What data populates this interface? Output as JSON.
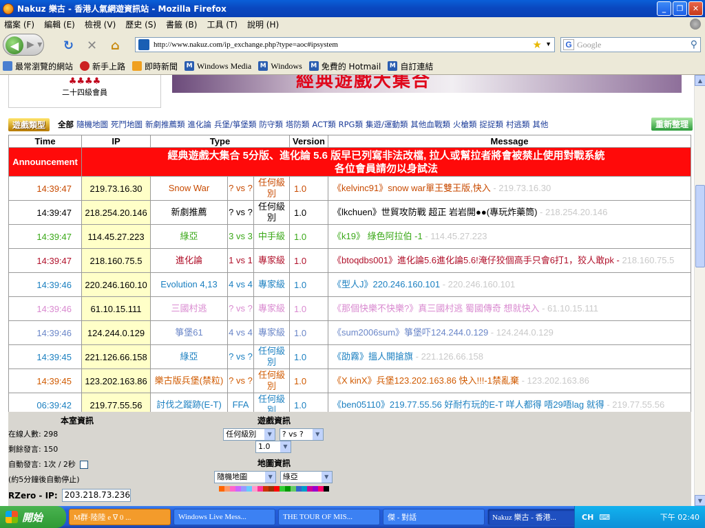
{
  "window": {
    "title": "Nakuz 樂古 - 香港人氣網遊資訊站 - Mozilla Firefox",
    "minimize": "_",
    "maximize": "❐",
    "close": "✕"
  },
  "menu": [
    "檔案 (F)",
    "編輯 (E)",
    "檢視 (V)",
    "歷史 (S)",
    "書籤 (B)",
    "工具 (T)",
    "說明 (H)"
  ],
  "nav": {
    "url": "http://www.nakuz.com/ip_exchange.php?type=aoc#ipsystem",
    "search_placeholder": "Google"
  },
  "bookmarks": [
    "最常瀏覽的網站",
    "新手上路",
    "即時新聞",
    "Windows Media",
    "Windows",
    "免費的 Hotmail",
    "自訂連結"
  ],
  "member": {
    "stars": "♣♣♣♣",
    "level": "二十四級會員"
  },
  "banner_text": "經典遊戲大集合",
  "categories": {
    "label": "遊戲類型",
    "items": [
      "全部",
      "隨機地圖",
      "死鬥地圖",
      "新劇推薦類",
      "進化論",
      "兵堡/箏堡類",
      "防守類",
      "塔防類",
      "ACT類",
      "RPG類",
      "集遊/運動類",
      "其他血戰類",
      "火槍類",
      "捉捉類",
      "村逃類",
      "其他"
    ],
    "refresh": "重新整理"
  },
  "table": {
    "headers": [
      "Time",
      "IP",
      "Type",
      "Version",
      "Message"
    ],
    "announcement_label": "Announcement",
    "announcement": [
      "經典遊戲大集合 5分版、進化論 5.6 版早已列寫非法改檔, 拉人或幫拉者將會被禁止使用對戰系統",
      "各位會員請勿以身試法"
    ],
    "rows": [
      {
        "time": "14:39:47",
        "ip": "219.73.16.30",
        "name": "Snow War",
        "vs": "? vs ?",
        "level": "任何級別",
        "version": "1.0",
        "msg": "《kelvinc91》snow war單王雙王版,快入",
        "msg_ip": " - 219.73.16.30",
        "color": "#c84a00"
      },
      {
        "time": "14:39:47",
        "ip": "218.254.20.146",
        "name": "新劇推薦",
        "vs": "? vs ?",
        "level": "任何級別",
        "version": "1.0",
        "msg": "《lkchuen》世貿攻防戰 超正 岩岩開●●(專玩炸藥筒)",
        "msg_ip": " - 218.254.20.146",
        "color": "#000000"
      },
      {
        "time": "14:39:47",
        "ip": "114.45.27.223",
        "name": "綠亞",
        "vs": "3 vs 3",
        "level": "中手級",
        "version": "1.0",
        "msg": "《k19》 綠色阿拉伯 -1",
        "msg_ip": " - 114.45.27.223",
        "color": "#3aa818"
      },
      {
        "time": "14:39:47",
        "ip": "218.160.75.5",
        "name": "進化論",
        "vs": "1 vs 1",
        "level": "專家級",
        "version": "1.0",
        "msg": "《btoqdbs001》進化論5.6進化論5.6!淹仔狡個高手只會6打1，狡人敢pk -",
        "msg_ip": " 218.160.75.5",
        "color": "#b0102a"
      },
      {
        "time": "14:39:46",
        "ip": "220.246.160.10",
        "name": "Evolution 4,13",
        "vs": "4 vs 4",
        "level": "專家級",
        "version": "1.0",
        "msg": "《型人J》220.246.160.101",
        "msg_ip": " - 220.246.160.101",
        "color": "#1a7fc0"
      },
      {
        "time": "14:39:46",
        "ip": "61.10.15.111",
        "name": "三國村逃",
        "vs": "? vs ?",
        "level": "專家級",
        "version": "1.0",
        "msg": "《那個快樂不快樂?》真三國村逃 蜀國傳奇 想就快入",
        "msg_ip": " - 61.10.15.111",
        "color": "#d98ad0"
      },
      {
        "time": "14:39:46",
        "ip": "124.244.0.129",
        "name": "箏堡61",
        "vs": "4 vs 4",
        "level": "專家級",
        "version": "1.0",
        "msg": "《sum2006sum》箏堡吓124.244.0.129",
        "msg_ip": " - 124.244.0.129",
        "color": "#6a86c8"
      },
      {
        "time": "14:39:45",
        "ip": "221.126.66.158",
        "name": "綠亞",
        "vs": "? vs ?",
        "level": "任何級別",
        "version": "1.0",
        "msg": "《劭霧》搵人開搶旗",
        "msg_ip": " - 221.126.66.158",
        "color": "#1a7fc0"
      },
      {
        "time": "14:39:45",
        "ip": "123.202.163.86",
        "name": "樂古版兵堡(禁粒)",
        "vs": "? vs ?",
        "level": "任何級別",
        "version": "1.0",
        "msg": "《X kinX》兵堡123.202.163.86 快入!!!-1禁亂棄",
        "msg_ip": " - 123.202.163.86",
        "color": "#d05a00"
      },
      {
        "time": "06:39:42",
        "ip": "219.77.55.56",
        "name": "討伐之蹤跡(E-T)",
        "vs": "FFA",
        "level": "任何級別",
        "version": "1.0",
        "msg": "《ben05110》219.77.55.56 好耐冇玩的E-T 咩人都得 唔29唔lag 就得",
        "msg_ip": " - 219.77.55.56",
        "color": "#1a7fc0"
      }
    ]
  },
  "panel": {
    "room_title": "本室資訊",
    "online": "在線人數: 298",
    "remaining": "剩餘發言: 150",
    "auto": "自動發言: 1次 / 2秒",
    "auto_note": "(約5分鐘後自動停止)",
    "rzero_label": "RZero - IP:",
    "rzero_ip": "203.218.73.236",
    "game_title": "遊戲資訊",
    "sel_level": "任何級別",
    "sel_vs": "? vs ?",
    "sel_ver": "1.0",
    "map_title": "地圖資訊",
    "sel_map": "隨機地圖",
    "sel_map2": "綠亞",
    "palette": [
      "#ff6600",
      "#ff9966",
      "#ff66cc",
      "#cc66ff",
      "#9999ff",
      "#66ccff",
      "#ff99cc",
      "#ff3399",
      "#cc3300",
      "#993300",
      "#ff0000",
      "#33cc33",
      "#009900",
      "#66cc66",
      "#3366cc",
      "#0099cc",
      "#cc0099",
      "#9900cc",
      "#ff0066",
      "#000000"
    ]
  },
  "taskbar": {
    "start": "開始",
    "tasks": [
      "M群·陸陸 e ∇ 0 ...",
      "Windows Live Mess...",
      "THE TOUR OF MIS...",
      "傑 - 對話",
      "Nakuz 樂古 - 香港..."
    ],
    "ime": "CH",
    "clock": "下午 02:40"
  }
}
